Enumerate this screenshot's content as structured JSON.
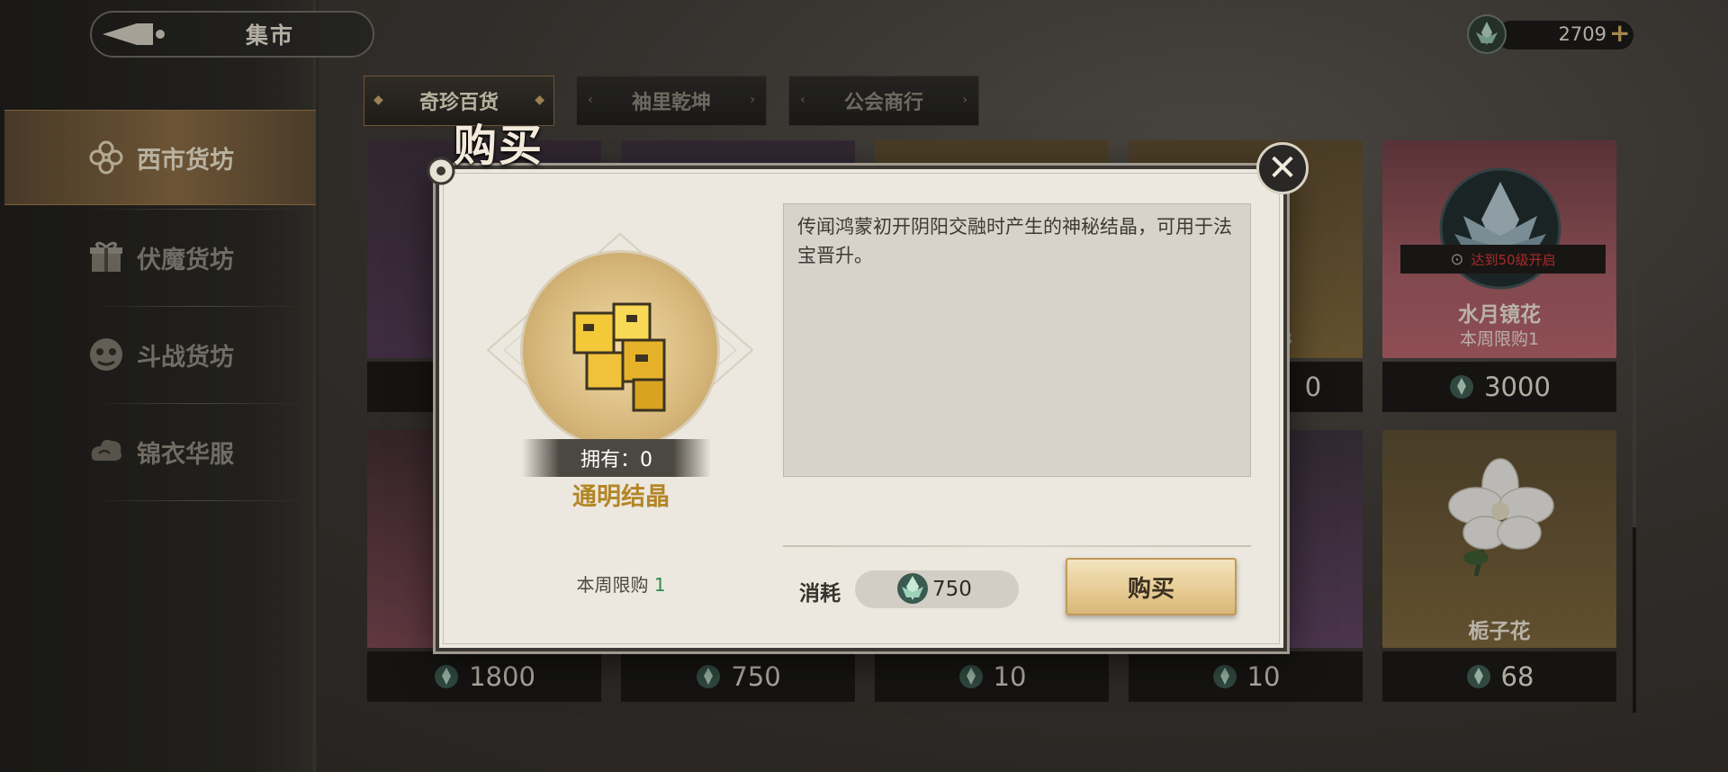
{
  "header": {
    "title": "集市",
    "currency_amount": "2709",
    "plus_label": "+"
  },
  "sidebar": {
    "items": [
      {
        "label": "西市货坊",
        "icon": "knot-icon",
        "active": true
      },
      {
        "label": "伏魔货坊",
        "icon": "gift-icon",
        "active": false
      },
      {
        "label": "斗战货坊",
        "icon": "mask-icon",
        "active": false
      },
      {
        "label": "锦衣华服",
        "icon": "cloud-icon",
        "active": false
      }
    ]
  },
  "tabs": [
    {
      "label": "奇珍百货",
      "active": true
    },
    {
      "label": "袖里乾坤",
      "active": false
    },
    {
      "label": "公会商行",
      "active": false
    }
  ],
  "shop": {
    "row1": [
      {
        "price": "",
        "title": "",
        "sub": ""
      },
      {
        "price": "",
        "title": "",
        "sub": ""
      },
      {
        "price": "",
        "title": "",
        "sub": ""
      },
      {
        "price": "0",
        "title": "",
        "sub": "8"
      },
      {
        "price": "3000",
        "title": "水月镜花",
        "sub": "本周限购1",
        "lock_text": "达到50级开启"
      }
    ],
    "row2": [
      {
        "price": "1800"
      },
      {
        "price": "750"
      },
      {
        "price": "10"
      },
      {
        "price": "10"
      },
      {
        "price": "68",
        "title": "栀子花"
      }
    ]
  },
  "modal": {
    "title": "购买",
    "close_label": "✕",
    "owned_label": "拥有：0",
    "item_name": "通明结晶",
    "weekly_limit_label": "本周限购",
    "weekly_limit_value": "1",
    "description": "传闻鸿蒙初开阴阳交融时产生的神秘结晶，可用于法宝晋升。",
    "cost_label": "消耗",
    "cost_value": "750",
    "buy_label": "购买"
  },
  "colors": {
    "accent_gold": "#b38626",
    "active_tab": "#8a6a42",
    "limit_green": "#2e8a4a"
  }
}
